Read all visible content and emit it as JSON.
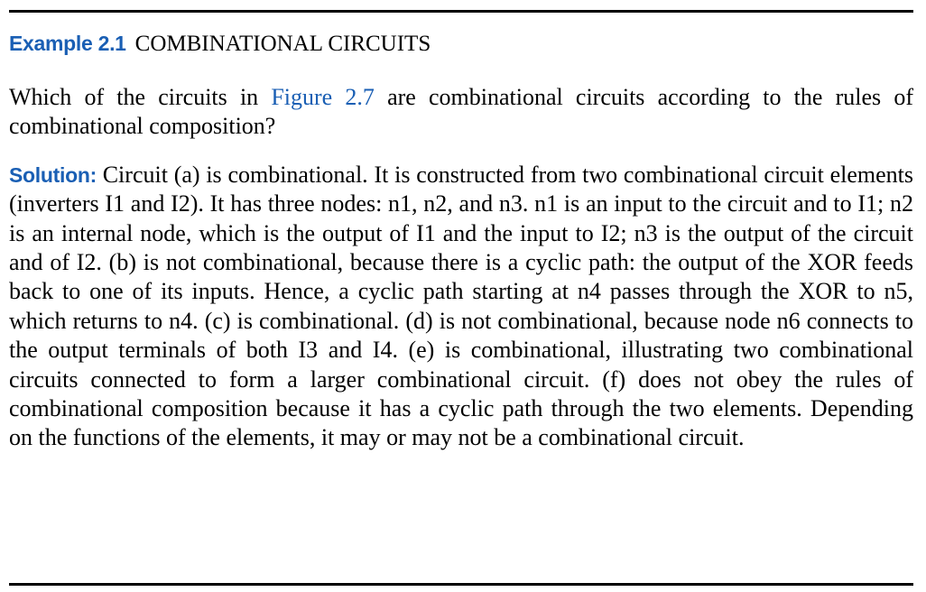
{
  "example": {
    "label": "Example 2.1",
    "title": "COMBINATIONAL CIRCUITS"
  },
  "question": {
    "text_before": "Which of the circuits in ",
    "figure_ref": "Figure 2.7",
    "text_after": " are combinational circuits according to the rules of combinational composition?"
  },
  "solution": {
    "label": "Solution:",
    "text": "Circuit (a) is combinational. It is constructed from two combinational circuit elements (inverters I1 and I2). It has three nodes: n1, n2, and n3. n1 is an input to the circuit and to I1; n2 is an internal node, which is the output of I1 and the input to I2; n3 is the output of the circuit and of I2. (b) is not combina­tional, because there is a cyclic path: the output of the XOR feeds back to one of its inputs. Hence, a cyclic path starting at n4 passes through the XOR to n5, which returns to n4. (c) is combinational. (d) is not combinational, because node n6 connects to the output terminals of both I3 and I4. (e) is combinational, illus­trating two combinational circuits connected to form a larger combinational circuit. (f) does not obey the rules of combinational composition because it has a cyclic path through the two elements. Depending on the functions of the elements, it may or may not be a combinational circuit."
  },
  "colors": {
    "accent": "#1a5fb4",
    "text": "#000000",
    "rule": "#000000"
  }
}
